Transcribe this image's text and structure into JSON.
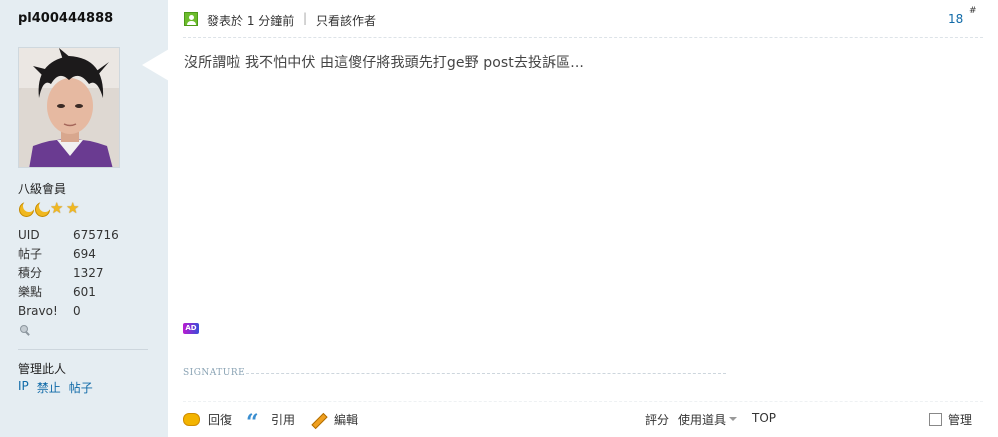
{
  "author": {
    "username": "pl400444888",
    "rank": "八級會員",
    "stats": [
      {
        "label": "UID",
        "value": "675716"
      },
      {
        "label": "帖子",
        "value": "694"
      },
      {
        "label": "積分",
        "value": "1327"
      },
      {
        "label": "樂點",
        "value": "601"
      },
      {
        "label": "Bravo!",
        "value": "0"
      }
    ],
    "manage_label": "管理此人",
    "manage_links": [
      "IP",
      "禁止",
      "帖子"
    ]
  },
  "post": {
    "posted": "發表於 1 分鐘前",
    "separator": "|",
    "only_author": "只看該作者",
    "floor": "18",
    "floor_mark": "#",
    "message": "沒所謂啦 我不怕中伏 由這傻仔將我頭先打ge野 post去投訴區...",
    "ad_badge": "AD",
    "signature_label": "SIGNATURE"
  },
  "actions": {
    "reply": "回復",
    "quote": "引用",
    "edit": "編輯",
    "rate": "評分",
    "tools": "使用道具",
    "top": "TOP",
    "manage": "管理"
  },
  "icons": [
    "user-icon",
    "reply-icon",
    "quote-icon",
    "edit-icon",
    "online-status-icon",
    "moon-icon",
    "star-icon"
  ]
}
